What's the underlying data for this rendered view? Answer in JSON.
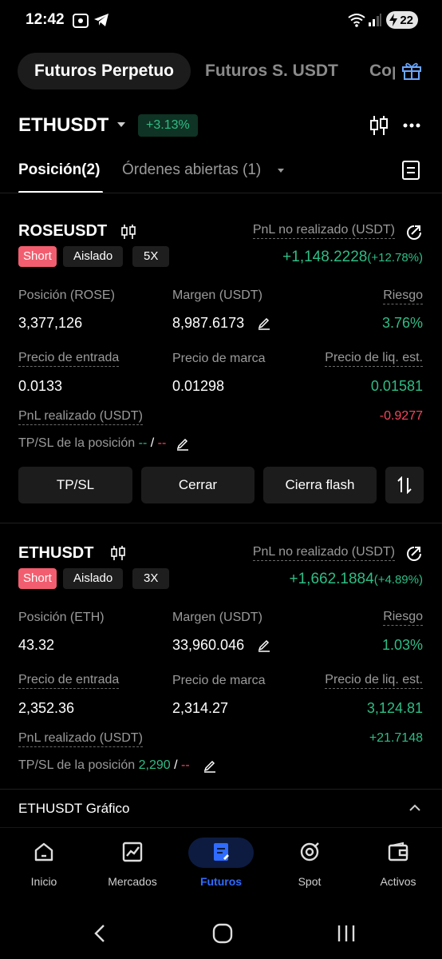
{
  "status_bar": {
    "time": "12:42",
    "battery": "22"
  },
  "top_tabs": {
    "active": "Futuros Perpetuo",
    "second": "Futuros S. USDT",
    "third": "Copy"
  },
  "header": {
    "symbol": "ETHUSDT",
    "change": "+3.13%"
  },
  "sub_tabs": {
    "positions": "Posición(2)",
    "orders": "Órdenes abiertas (1)"
  },
  "positions": [
    {
      "symbol": "ROSEUSDT",
      "side": "Short",
      "mode": "Aislado",
      "leverage": "5X",
      "pnl_label": "PnL no realizado (USDT)",
      "pnl_value": "+1,148.2228",
      "pnl_pct": "(+12.78%)",
      "size_label": "Posición (ROSE)",
      "size": "3,377,126",
      "margin_label": "Margen (USDT)",
      "margin": "8,987.6173",
      "risk_label": "Riesgo",
      "risk": "3.76%",
      "entry_label": "Precio de entrada",
      "entry": "0.0133",
      "mark_label": "Precio de marca",
      "mark": "0.01298",
      "liq_label": "Precio de liq. est.",
      "liq": "0.01581",
      "realized_label": "PnL realizado (USDT)",
      "realized": "-0.9277",
      "tpsl_label": "TP/SL de la posición",
      "tp": "--",
      "sl": "--"
    },
    {
      "symbol": "ETHUSDT",
      "side": "Short",
      "mode": "Aislado",
      "leverage": "3X",
      "pnl_label": "PnL no realizado (USDT)",
      "pnl_value": "+1,662.1884",
      "pnl_pct": "(+4.89%)",
      "size_label": "Posición (ETH)",
      "size": "43.32",
      "margin_label": "Margen (USDT)",
      "margin": "33,960.046",
      "risk_label": "Riesgo",
      "risk": "1.03%",
      "entry_label": "Precio de entrada",
      "entry": "2,352.36",
      "mark_label": "Precio de marca",
      "mark": "2,314.27",
      "liq_label": "Precio de liq. est.",
      "liq": "3,124.81",
      "realized_label": "PnL realizado (USDT)",
      "realized": "+21.7148",
      "tpsl_label": "TP/SL de la posición",
      "tp": "2,290",
      "sl": "--"
    }
  ],
  "actions": {
    "tpsl": "TP/SL",
    "close": "Cerrar",
    "flash_close": "Cierra flash"
  },
  "chart_section": {
    "label": "ETHUSDT Gráfico"
  },
  "bottom_nav": [
    {
      "label": "Inicio",
      "icon": "home-icon"
    },
    {
      "label": "Mercados",
      "icon": "markets-icon"
    },
    {
      "label": "Futuros",
      "icon": "futures-icon"
    },
    {
      "label": "Spot",
      "icon": "spot-icon"
    },
    {
      "label": "Activos",
      "icon": "wallet-icon"
    }
  ],
  "colors": {
    "green": "#2ebd85",
    "red": "#f6465d",
    "accent": "#2f6bff",
    "short_tag": "#f25e6f"
  }
}
